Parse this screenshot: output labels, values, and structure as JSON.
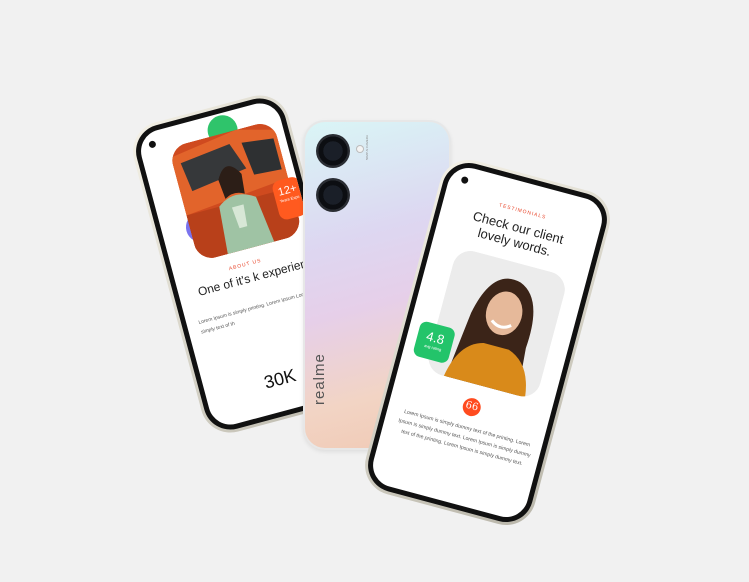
{
  "left_phone": {
    "section_label": "ABOUT US",
    "heading": "One of it's k experience b",
    "paragraph": "Lorem Ipsum is simply printing. Lorem Ipsum Lorem Ipsum is simply text of th",
    "stat_value": "30K",
    "badge_value": "12+",
    "badge_text": "Years Expe"
  },
  "back_phone": {
    "brand": "realme",
    "camera_text": "50MP AI CAMERA"
  },
  "right_phone": {
    "section_label": "TESTIMONIALS",
    "heading_line1": "Check our client",
    "heading_line2": "lovely words.",
    "rating_value": "4.8",
    "rating_label": "avg rating",
    "quote_icon": "66",
    "paragraph": "Lorem Ipsum is simply dummy text of the printing. Lorem Ipsum is simply dummy text. Lorem Ipsum is simply dummy text of the printing. Lorem Ipsum is simply dummy text."
  },
  "colors": {
    "accent_orange": "#ff5a1f",
    "accent_green": "#23c46a",
    "accent_red": "#e8462b"
  }
}
